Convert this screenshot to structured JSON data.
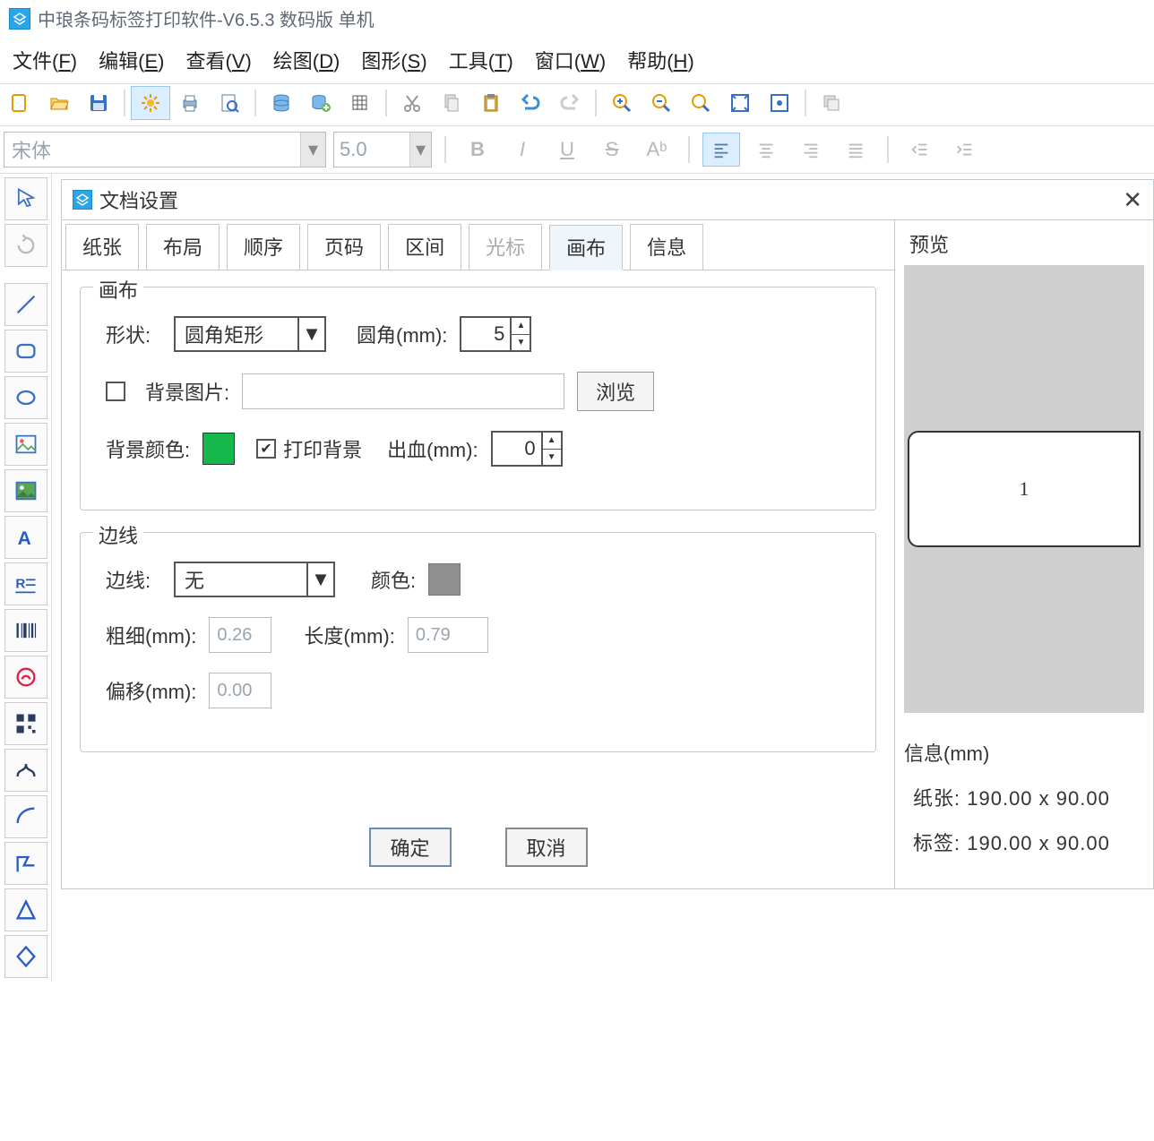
{
  "title": "中琅条码标签打印软件-V6.5.3 数码版 单机",
  "menu": [
    "文件(F)",
    "编辑(E)",
    "查看(V)",
    "绘图(D)",
    "图形(S)",
    "工具(T)",
    "窗口(W)",
    "帮助(H)"
  ],
  "font": {
    "name": "宋体",
    "size": "5.0"
  },
  "dialog": {
    "title": "文档设置",
    "tabs": [
      "纸张",
      "布局",
      "顺序",
      "页码",
      "区间",
      "光标",
      "画布",
      "信息"
    ],
    "disabled_tab": "光标",
    "active_tab": "画布",
    "canvas": {
      "legend": "画布",
      "shape_label": "形状:",
      "shape_value": "圆角矩形",
      "corner_label": "圆角(mm):",
      "corner_value": "5",
      "bgimg_label": "背景图片:",
      "bgimg_checked": false,
      "browse": "浏览",
      "bgcolor_label": "背景颜色:",
      "printbg_label": "打印背景",
      "printbg_checked": true,
      "bleed_label": "出血(mm):",
      "bleed_value": "0"
    },
    "border": {
      "legend": "边线",
      "border_label": "边线:",
      "border_value": "无",
      "color_label": "颜色:",
      "thick_label": "粗细(mm):",
      "thick_value": "0.26",
      "length_label": "长度(mm):",
      "length_value": "0.79",
      "offset_label": "偏移(mm):",
      "offset_value": "0.00"
    },
    "ok": "确定",
    "cancel": "取消"
  },
  "preview": {
    "title": "预览",
    "label_text": "1",
    "info_title": "信息(mm)",
    "paper_label": "纸张:",
    "paper_value": "190.00 x 90.00",
    "tag_label": "标签:",
    "tag_value": "190.00 x 90.00"
  }
}
